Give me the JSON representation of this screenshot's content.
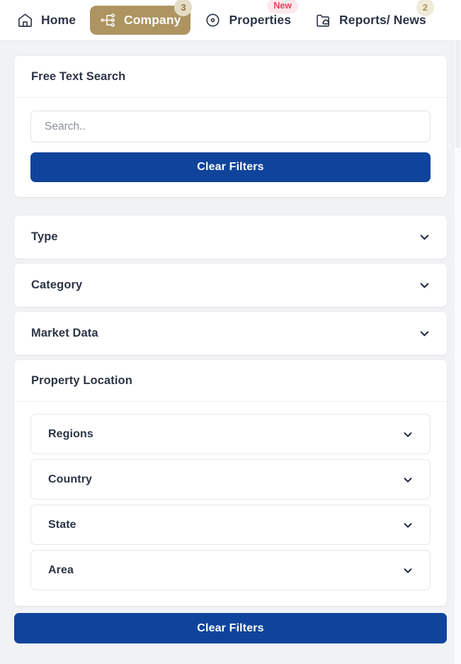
{
  "nav": {
    "items": [
      {
        "label": "Home",
        "icon": "home-icon",
        "active": false,
        "badge": null,
        "badge_type": null
      },
      {
        "label": "Company",
        "icon": "org-chart-icon",
        "active": true,
        "badge": "3",
        "badge_type": "count"
      },
      {
        "label": "Properties",
        "icon": "circle-dot-icon",
        "active": false,
        "badge": "New",
        "badge_type": "new"
      },
      {
        "label": "Reports/ News",
        "icon": "folder-cloud-icon",
        "active": false,
        "badge": "2",
        "badge_type": "count"
      }
    ]
  },
  "search_card": {
    "title": "Free Text Search",
    "input_value": "",
    "input_placeholder": "Search..",
    "clear_button": "Clear Filters"
  },
  "filters": {
    "accordions": [
      {
        "label": "Type",
        "expanded": false
      },
      {
        "label": "Category",
        "expanded": false
      },
      {
        "label": "Market Data",
        "expanded": false
      }
    ],
    "location": {
      "title": "Property Location",
      "selects": [
        {
          "label": "Regions",
          "value": ""
        },
        {
          "label": "Country",
          "value": ""
        },
        {
          "label": "State",
          "value": ""
        },
        {
          "label": "Area",
          "value": ""
        }
      ]
    },
    "clear_button": "Clear Filters"
  },
  "colors": {
    "accent_gold": "#ad9460",
    "primary_blue": "#10449c",
    "badge_new_bg": "#fde8ec",
    "badge_new_fg": "#e8415f",
    "badge_count_bg": "#f0ead9",
    "badge_count_fg": "#ad9460",
    "page_bg": "#f1f2f4",
    "card_bg": "#ffffff",
    "text_primary": "#2c3446",
    "placeholder": "#8a919d"
  }
}
